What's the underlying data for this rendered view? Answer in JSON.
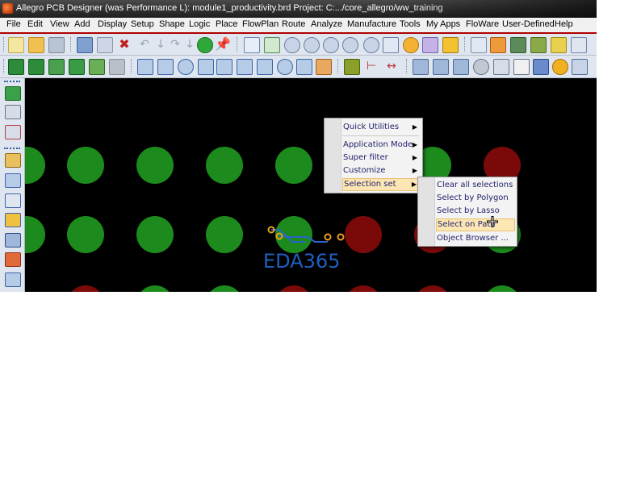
{
  "window": {
    "title": "Allegro PCB Designer (was Performance L): module1_productivity.brd  Project: C:.../core_allegro/ww_training"
  },
  "menubar": {
    "items": [
      "File",
      "Edit",
      "View",
      "Add",
      "Display",
      "Setup",
      "Shape",
      "Logic",
      "Place",
      "FlowPlan",
      "Route",
      "Analyze",
      "Manufacture",
      "Tools",
      "My Apps",
      "FloWare",
      "User-Defined",
      "Help"
    ]
  },
  "toolbar1": {
    "icons": [
      "new-file-icon",
      "open-folder-icon",
      "save-icon",
      "move-icon",
      "copy-icon",
      "delete-icon",
      "undo-icon",
      "undo-arrow-icon",
      "redo-icon",
      "redo-arrow-icon",
      "pin-icon",
      "pushpin-icon",
      "grid-icon",
      "grid-snap-icon",
      "zoom-fit-icon",
      "zoom-in-icon",
      "zoom-in-alt-icon",
      "zoom-out-icon",
      "zoom-previous-icon",
      "zoom-world-icon",
      "refresh-icon",
      "3d-view-icon",
      "ltl-icon",
      "grid-toggle-icon",
      "color-icon",
      "layers-icon",
      "spreadsheet-icon",
      "table-icon",
      "constraint-icon"
    ]
  },
  "toolbar2": {
    "icons": [
      "ratsnest-icon",
      "unrats-icon",
      "show-all-icon",
      "blank-icon",
      "disabled-icon",
      "shape-corner-icon",
      "rectangle-icon",
      "circle-icon",
      "select-icon",
      "shape-merge-icon",
      "shape-edit-icon",
      "square-icon",
      "round-icon",
      "measure-icon",
      "stack-icon",
      "component-icon",
      "dimension-icon",
      "dimension-horizontal-icon",
      "via-icon",
      "book-icon",
      "walk-icon",
      "camera-icon",
      "drc-icon",
      "flag-icon",
      "panel-icon",
      "key-icon",
      "matrix-icon"
    ]
  },
  "leftbar": {
    "icons": [
      "place-icon",
      "component-box-icon",
      "connect-icon",
      "slide-icon",
      "spread-icon",
      "delay-tune-icon",
      "fanout-icon",
      "bus-icon",
      "custom-smooth-icon",
      "phase-icon"
    ]
  },
  "canvas": {
    "watermark": "EDA365"
  },
  "context_menu": {
    "items": [
      {
        "label": "Quick Utilities",
        "submenu": "▶"
      },
      {
        "label": "Application Mode",
        "submenu": "▶"
      },
      {
        "label": "Super filter",
        "submenu": "▶"
      },
      {
        "label": "Customize",
        "submenu": "▶"
      },
      {
        "label": "Selection set",
        "submenu": "▶",
        "active": true
      }
    ]
  },
  "submenu": {
    "items": [
      {
        "label": "Clear all selections"
      },
      {
        "label": "Select by Polygon"
      },
      {
        "label": "Select by Lasso"
      },
      {
        "label": "Select on Path",
        "active": true
      },
      {
        "label": "Object Browser ..."
      }
    ]
  },
  "colors": {
    "pad_green": "#1d8a1d",
    "pad_red": "#7a0a0a",
    "highlight": "#fbe6b4",
    "menubar_accent": "#b00000"
  }
}
